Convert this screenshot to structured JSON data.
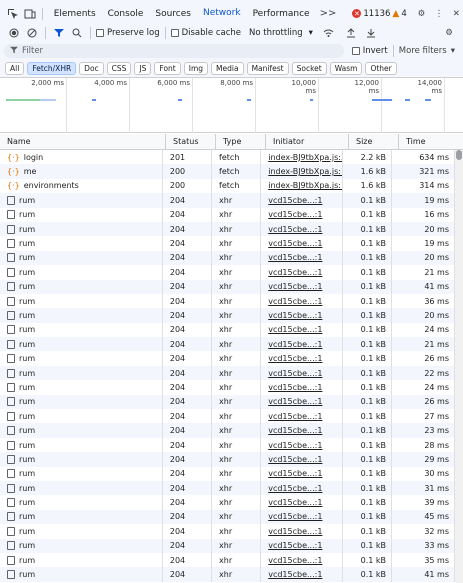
{
  "tabs": [
    "Elements",
    "Console",
    "Sources",
    "Network",
    "Performance"
  ],
  "active_tab": "Network",
  "more_tabs": ">>",
  "issues": {
    "errors": "11136",
    "warnings": "4"
  },
  "toolbar": {
    "preserve_log": "Preserve log",
    "disable_cache": "Disable cache",
    "throttling": "No throttling"
  },
  "filter": {
    "placeholder": "Filter",
    "invert": "Invert",
    "more_filters": "More filters"
  },
  "chips": [
    "All",
    "Fetch/XHR",
    "Doc",
    "CSS",
    "JS",
    "Font",
    "Img",
    "Media",
    "Manifest",
    "Socket",
    "Wasm",
    "Other"
  ],
  "active_chip": "Fetch/XHR",
  "overview": {
    "ticks": [
      "2,000 ms",
      "4,000 ms",
      "6,000 ms",
      "8,000 ms",
      "10,000 ms",
      "12,000 ms",
      "14,000 ms"
    ]
  },
  "headers": {
    "name": "Name",
    "status": "Status",
    "type": "Type",
    "initiator": "Initiator",
    "size": "Size",
    "time": "Time"
  },
  "rows": [
    {
      "name": "login",
      "status": "201",
      "type": "fetch",
      "initiator": "index-BJ9tbXpa.js:32",
      "size": "2.2 kB",
      "time": "634 ms",
      "kind": "fetch"
    },
    {
      "name": "me",
      "status": "200",
      "type": "fetch",
      "initiator": "index-BJ9tbXpa.js:18",
      "size": "1.6 kB",
      "time": "321 ms",
      "kind": "fetch"
    },
    {
      "name": "environments",
      "status": "200",
      "type": "fetch",
      "initiator": "index-BJ9tbXpa.js:18",
      "size": "1.6 kB",
      "time": "314 ms",
      "kind": "fetch"
    },
    {
      "name": "rum",
      "status": "204",
      "type": "xhr",
      "initiator": "vcd15cbe...:1",
      "size": "0.1 kB",
      "time": "19 ms",
      "kind": "xhr"
    },
    {
      "name": "rum",
      "status": "204",
      "type": "xhr",
      "initiator": "vcd15cbe...:1",
      "size": "0.1 kB",
      "time": "16 ms",
      "kind": "xhr"
    },
    {
      "name": "rum",
      "status": "204",
      "type": "xhr",
      "initiator": "vcd15cbe...:1",
      "size": "0.1 kB",
      "time": "20 ms",
      "kind": "xhr"
    },
    {
      "name": "rum",
      "status": "204",
      "type": "xhr",
      "initiator": "vcd15cbe...:1",
      "size": "0.1 kB",
      "time": "19 ms",
      "kind": "xhr"
    },
    {
      "name": "rum",
      "status": "204",
      "type": "xhr",
      "initiator": "vcd15cbe...:1",
      "size": "0.1 kB",
      "time": "20 ms",
      "kind": "xhr"
    },
    {
      "name": "rum",
      "status": "204",
      "type": "xhr",
      "initiator": "vcd15cbe...:1",
      "size": "0.1 kB",
      "time": "21 ms",
      "kind": "xhr"
    },
    {
      "name": "rum",
      "status": "204",
      "type": "xhr",
      "initiator": "vcd15cbe...:1",
      "size": "0.1 kB",
      "time": "41 ms",
      "kind": "xhr"
    },
    {
      "name": "rum",
      "status": "204",
      "type": "xhr",
      "initiator": "vcd15cbe...:1",
      "size": "0.1 kB",
      "time": "36 ms",
      "kind": "xhr"
    },
    {
      "name": "rum",
      "status": "204",
      "type": "xhr",
      "initiator": "vcd15cbe...:1",
      "size": "0.1 kB",
      "time": "20 ms",
      "kind": "xhr"
    },
    {
      "name": "rum",
      "status": "204",
      "type": "xhr",
      "initiator": "vcd15cbe...:1",
      "size": "0.1 kB",
      "time": "24 ms",
      "kind": "xhr"
    },
    {
      "name": "rum",
      "status": "204",
      "type": "xhr",
      "initiator": "vcd15cbe...:1",
      "size": "0.1 kB",
      "time": "21 ms",
      "kind": "xhr"
    },
    {
      "name": "rum",
      "status": "204",
      "type": "xhr",
      "initiator": "vcd15cbe...:1",
      "size": "0.1 kB",
      "time": "26 ms",
      "kind": "xhr"
    },
    {
      "name": "rum",
      "status": "204",
      "type": "xhr",
      "initiator": "vcd15cbe...:1",
      "size": "0.1 kB",
      "time": "22 ms",
      "kind": "xhr"
    },
    {
      "name": "rum",
      "status": "204",
      "type": "xhr",
      "initiator": "vcd15cbe...:1",
      "size": "0.1 kB",
      "time": "24 ms",
      "kind": "xhr"
    },
    {
      "name": "rum",
      "status": "204",
      "type": "xhr",
      "initiator": "vcd15cbe...:1",
      "size": "0.1 kB",
      "time": "26 ms",
      "kind": "xhr"
    },
    {
      "name": "rum",
      "status": "204",
      "type": "xhr",
      "initiator": "vcd15cbe...:1",
      "size": "0.1 kB",
      "time": "27 ms",
      "kind": "xhr"
    },
    {
      "name": "rum",
      "status": "204",
      "type": "xhr",
      "initiator": "vcd15cbe...:1",
      "size": "0.1 kB",
      "time": "23 ms",
      "kind": "xhr"
    },
    {
      "name": "rum",
      "status": "204",
      "type": "xhr",
      "initiator": "vcd15cbe...:1",
      "size": "0.1 kB",
      "time": "28 ms",
      "kind": "xhr"
    },
    {
      "name": "rum",
      "status": "204",
      "type": "xhr",
      "initiator": "vcd15cbe...:1",
      "size": "0.1 kB",
      "time": "29 ms",
      "kind": "xhr"
    },
    {
      "name": "rum",
      "status": "204",
      "type": "xhr",
      "initiator": "vcd15cbe...:1",
      "size": "0.1 kB",
      "time": "30 ms",
      "kind": "xhr"
    },
    {
      "name": "rum",
      "status": "204",
      "type": "xhr",
      "initiator": "vcd15cbe...:1",
      "size": "0.1 kB",
      "time": "31 ms",
      "kind": "xhr"
    },
    {
      "name": "rum",
      "status": "204",
      "type": "xhr",
      "initiator": "vcd15cbe...:1",
      "size": "0.1 kB",
      "time": "39 ms",
      "kind": "xhr"
    },
    {
      "name": "rum",
      "status": "204",
      "type": "xhr",
      "initiator": "vcd15cbe...:1",
      "size": "0.1 kB",
      "time": "45 ms",
      "kind": "xhr"
    },
    {
      "name": "rum",
      "status": "204",
      "type": "xhr",
      "initiator": "vcd15cbe...:1",
      "size": "0.1 kB",
      "time": "32 ms",
      "kind": "xhr"
    },
    {
      "name": "rum",
      "status": "204",
      "type": "xhr",
      "initiator": "vcd15cbe...:1",
      "size": "0.1 kB",
      "time": "33 ms",
      "kind": "xhr"
    },
    {
      "name": "rum",
      "status": "204",
      "type": "xhr",
      "initiator": "vcd15cbe...:1",
      "size": "0.1 kB",
      "time": "35 ms",
      "kind": "xhr"
    },
    {
      "name": "rum",
      "status": "204",
      "type": "xhr",
      "initiator": "vcd15cbe...:1",
      "size": "0.1 kB",
      "time": "41 ms",
      "kind": "xhr"
    }
  ],
  "colors": {
    "accent": "#0b57d0",
    "fetch_icon": "#e37400",
    "error": "#dc362e",
    "warning": "#e37400"
  }
}
